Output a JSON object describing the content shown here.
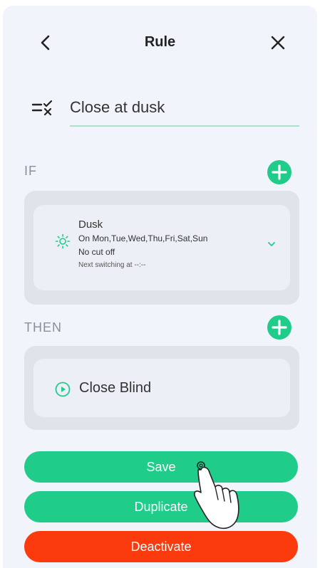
{
  "header": {
    "title": "Rule"
  },
  "rule": {
    "name": "Close at dusk"
  },
  "if_section": {
    "label": "IF",
    "condition": {
      "title": "Dusk",
      "days": "On Mon,Tue,Wed,Thu,Fri,Sat,Sun",
      "cutoff": "No cut off",
      "next_switching": "Next switching at --:--"
    }
  },
  "then_section": {
    "label": "THEN",
    "action": {
      "label": "Close Blind"
    }
  },
  "buttons": {
    "save": "Save",
    "duplicate": "Duplicate",
    "deactivate": "Deactivate"
  },
  "colors": {
    "accent": "#20cc8a",
    "danger": "#fb3a0d",
    "background": "#f1f4fa",
    "card": "#dfe3ea"
  },
  "icons": [
    "back-icon",
    "close-icon",
    "checklist-icon",
    "add-icon",
    "sun-icon",
    "chevron-down-icon",
    "play-icon",
    "hand-pointer-icon"
  ]
}
